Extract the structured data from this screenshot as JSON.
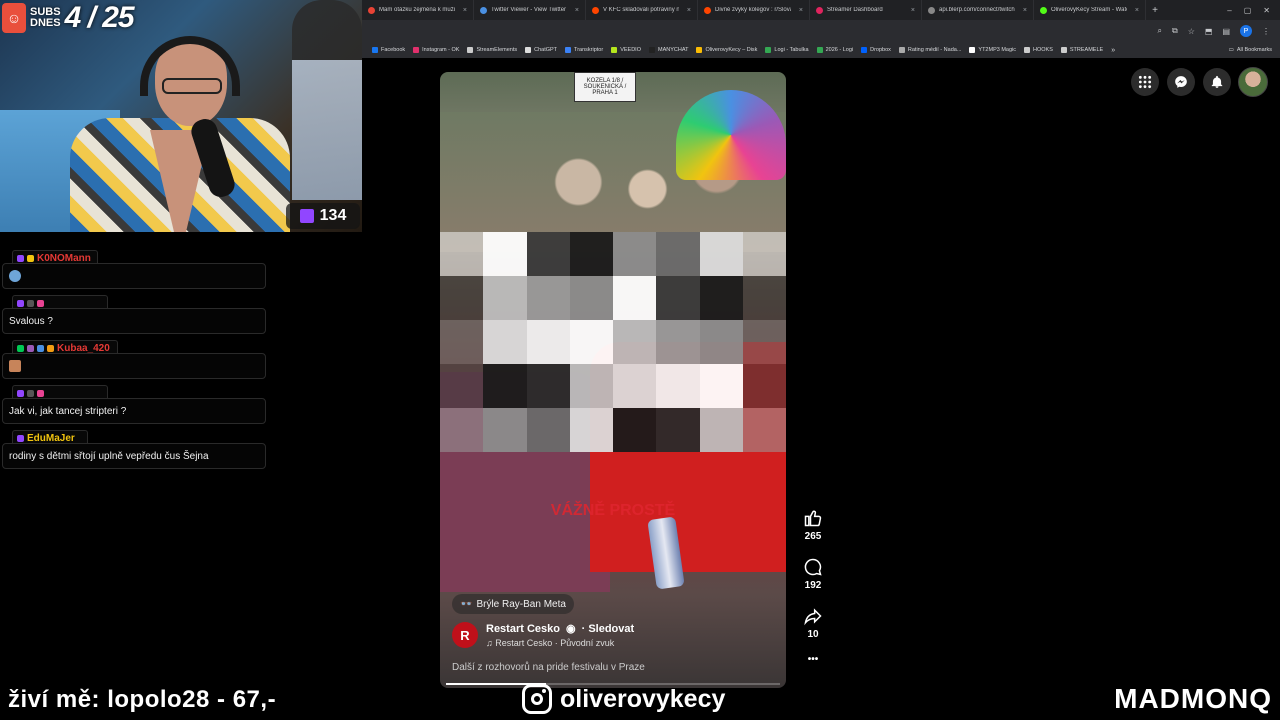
{
  "browser": {
    "tabs": [
      {
        "title": "Mam otázku zejména k mužů",
        "color": "#e94335"
      },
      {
        "title": "Twitter Viewer - View Twitter",
        "color": "#4a90e2"
      },
      {
        "title": "V KFC skladovali potraviny na",
        "color": "#ff4500"
      },
      {
        "title": "Divné zvyky kolegov : r/Slovak",
        "color": "#ff4500"
      },
      {
        "title": "Streamer Dashboard",
        "color": "#e0245e"
      },
      {
        "title": "api.blerp.com/connect/twitch",
        "color": "#888888"
      },
      {
        "title": "OliverovyKecy Stream - Watch",
        "color": "#53fc18"
      }
    ],
    "new_tab": "+",
    "window_controls": [
      "–",
      "▢",
      "✕"
    ],
    "profile_initial": "P",
    "bookmarks": [
      {
        "label": "Facebook",
        "color": "#1877f2"
      },
      {
        "label": "Instagram - OK",
        "color": "#e1306c"
      },
      {
        "label": "StreamElements",
        "color": "#cccccc"
      },
      {
        "label": "ChatGPT",
        "color": "#dddddd"
      },
      {
        "label": "Transkriptor",
        "color": "#3b82f6"
      },
      {
        "label": "VEEDIO",
        "color": "#b5e61d"
      },
      {
        "label": "MANYCHAT",
        "color": "#222222"
      },
      {
        "label": "OliverovyKecy – Disk",
        "color": "#fbbc04"
      },
      {
        "label": "Logi - Tabulka",
        "color": "#34a853"
      },
      {
        "label": "2026 - Logi",
        "color": "#34a853"
      },
      {
        "label": "Dropbox",
        "color": "#0061fe"
      },
      {
        "label": "Rating médií - Nada...",
        "color": "#aaaaaa"
      },
      {
        "label": "YT2MP3 Magic",
        "color": "#ffffff"
      },
      {
        "label": "HOOKS",
        "color": "#cccccc"
      },
      {
        "label": "STREAMELE",
        "color": "#cccccc"
      }
    ],
    "bookmarks_more": "»",
    "all_bookmarks": "All Bookmarks"
  },
  "webcam": {
    "subs_label_1": "SUBS",
    "subs_label_2": "DNES",
    "subs_count": "4 / 25",
    "viewer_count": "134"
  },
  "chat": [
    {
      "user": "K0NOMann",
      "user_color": "#e53935",
      "message": "",
      "emote": "round",
      "badges": [
        "#9146ff",
        "#f1c40f"
      ]
    },
    {
      "user": "",
      "user_color": "#ffffff",
      "message": "Svalous ?",
      "emote": "",
      "badges": [
        "#9146ff",
        "#555555",
        "#e84393"
      ]
    },
    {
      "user": "Kubaa_420",
      "user_color": "#e53935",
      "message": "",
      "emote": "square",
      "badges": [
        "#00c853",
        "#9b59b6",
        "#4a90e2",
        "#f39c12"
      ]
    },
    {
      "user": "",
      "user_color": "#ffffff",
      "message": "Jak vi, jak tancej stripteri ?",
      "emote": "",
      "badges": [
        "#9146ff",
        "#555555",
        "#e84393"
      ]
    },
    {
      "user": "EduMaJer",
      "user_color": "#f1c40f",
      "message": "rodiny s dětmi sřtojí uplně vepředu čus Šejna",
      "emote": "",
      "badges": [
        "#9146ff"
      ]
    }
  ],
  "video": {
    "sign_text": "KOZELA 1/8 / SOUKENICKÁ / PRAHA 1",
    "overlay_text": "VÁŽNĚ PROSTĚ",
    "meta_tag": "Brýle Ray-Ban Meta",
    "creator_initial": "R",
    "creator_name": "Restart Cesko",
    "follow_label": "· Sledovat",
    "audio_label": "♫ Restart Cesko · Původní zvuk",
    "caption": "Další z rozhovorů na pride festivalu v Praze",
    "progress": 0.3
  },
  "reactions": {
    "likes": "265",
    "comments": "192",
    "shares": "10"
  },
  "overlays": {
    "donor_text": "živí mě: lopolo28 - 67,-",
    "instagram_handle": "oliverovykecy",
    "brand": "MADMONQ"
  }
}
